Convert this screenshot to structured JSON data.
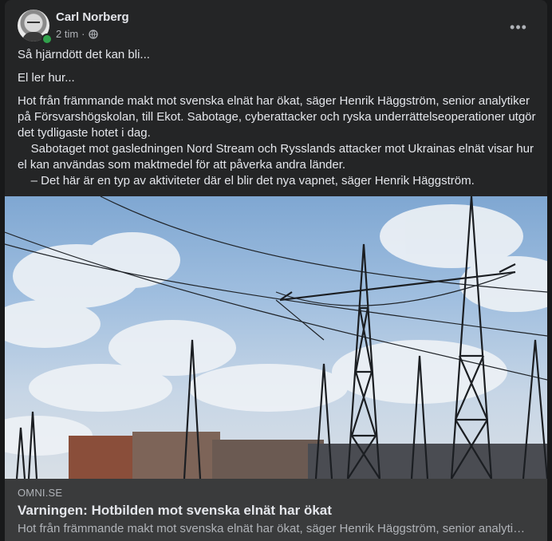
{
  "post": {
    "author": "Carl Norberg",
    "time": "2 tim",
    "separator": "·",
    "more_label": "•••",
    "text": {
      "line1": "Så hjärndött det kan bli...",
      "line2": "El ler hur...",
      "para1": "Hot från främmande makt mot svenska elnät har ökat, säger Henrik Häggström, senior analytiker på Försvarshögskolan, till Ekot. Sabotage, cyberattacker och ryska underrättelseoperationer utgör det tydligaste hotet i dag.",
      "para2": "    Sabotaget mot gasledningen Nord Stream och Rysslands attacker mot Ukrainas elnät visar hur el kan användas som maktmedel för att påverka andra länder.",
      "para3": "    – Det här är en typ av aktiviteter där el blir det nya vapnet, säger Henrik Häggström."
    }
  },
  "link": {
    "domain": "OMNI.SE",
    "title": "Varningen: Hotbilden mot svenska elnät har ökat",
    "description": "Hot från främmande makt mot svenska elnät har ökat, säger Henrik Häggström, senior analytiker på Försvarshögskolan, till Ekot."
  },
  "icons": {
    "audience": "globe-icon",
    "menu": "more-horizontal-icon",
    "presence": "online-dot"
  },
  "colors": {
    "card": "#242526",
    "page": "#18191a",
    "online": "#31a24c",
    "preview": "#3a3b3c"
  }
}
